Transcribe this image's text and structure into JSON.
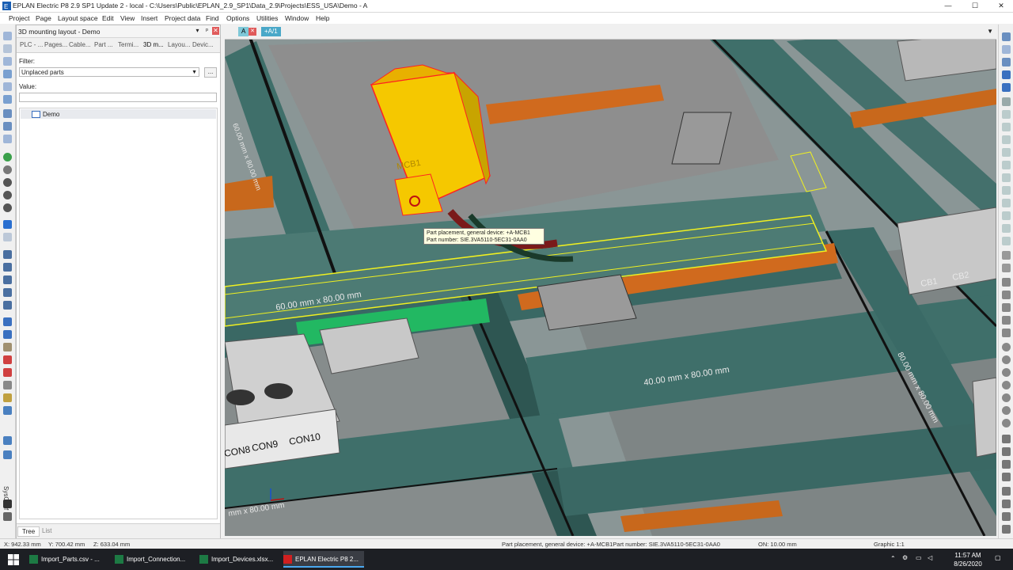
{
  "window": {
    "title": "EPLAN Electric P8 2.9 SP1 Update 2 - local - C:\\Users\\Public\\EPLAN_2.9_SP1\\Data_2.9\\Projects\\ESS_USA\\Demo - A",
    "minimize": "—",
    "maximize": "☐",
    "close": "✕"
  },
  "menu": [
    "Project",
    "Page",
    "Layout space",
    "Edit",
    "View",
    "Insert",
    "Project data",
    "Find",
    "Options",
    "Utilities",
    "Window",
    "Help"
  ],
  "panel": {
    "title": "3D mounting layout - Demo",
    "tabs": [
      "PLC - ...",
      "Pages...",
      "Cable...",
      "Part ...",
      "Termi...",
      "3D m...",
      "Layou...",
      "Devic..."
    ],
    "filter_label": "Filter:",
    "filter_value": "Unplaced parts",
    "ellipsis": "...",
    "value_label": "Value:",
    "tree_item": "Demo",
    "bottom_tabs": [
      "Tree",
      "List"
    ]
  },
  "left_sidebar": {
    "vertical_tab": "SysConf"
  },
  "viewport": {
    "tabs": [
      "A",
      "+A/1"
    ],
    "dimension_labels": [
      "60.00 mm x 80.00 mm",
      "60.00 mm x 80.00 mm",
      "40.00 mm x 80.00 mm",
      "80.00 mm x 80.00 mm",
      "mm x 80.00 mm"
    ],
    "device_label": "MCB1",
    "connector_labels": [
      "CON8",
      "CON9",
      "CON10"
    ],
    "breaker_labels": [
      "CB1",
      "CB2"
    ],
    "tooltip": {
      "line1": "Part placement, general device: +A-MCB1",
      "line2": "Part number: SIE.3VA5110-5EC31-0AA0"
    }
  },
  "status": {
    "x": "X: 942.33 mm",
    "y": "Y: 700.42 mm",
    "z": "Z: 633.04 mm",
    "info": "Part placement, general device: +A-MCB1Part number: SIE.3VA5110-5EC31-0AA0",
    "on": "ON: 10.00 mm",
    "graphic": "Graphic 1:1"
  },
  "taskbar": {
    "items": [
      "Import_Parts.csv - ...",
      "Import_Connection...",
      "Import_Devices.xlsx...",
      "EPLAN Electric P8 2..."
    ],
    "time": "11:57 AM",
    "date": "8/26/2020"
  }
}
